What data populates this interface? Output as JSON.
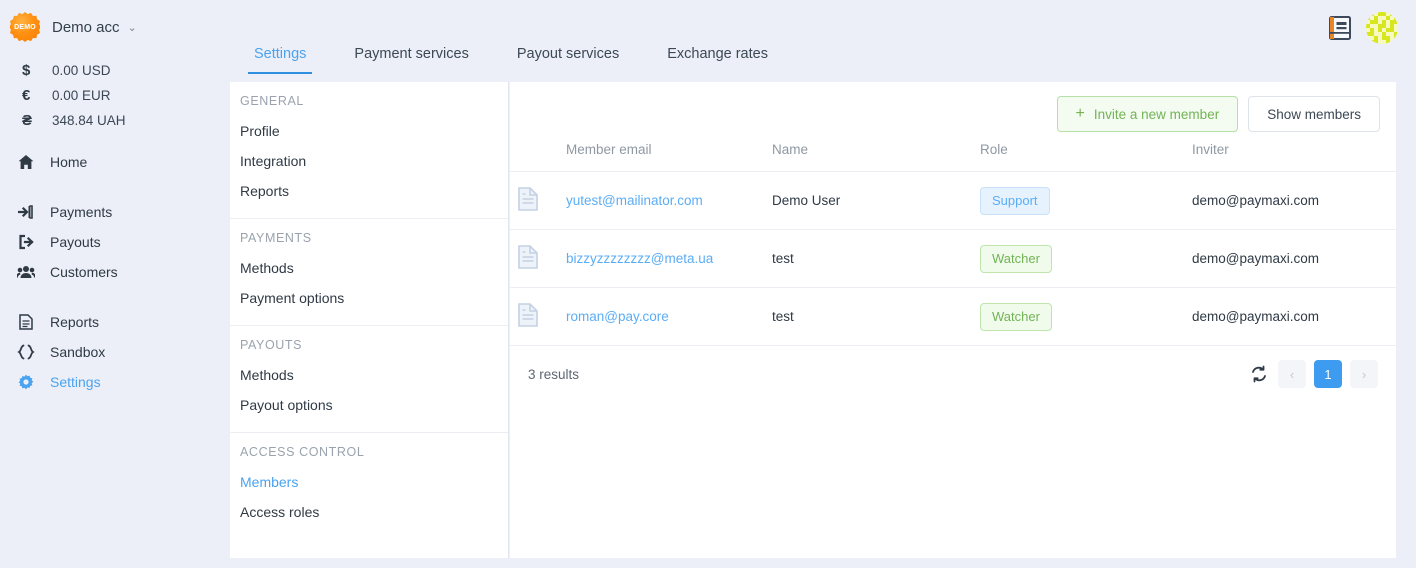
{
  "account": {
    "badge_text": "DEMO",
    "name": "Demo acc",
    "caret": "⌄"
  },
  "balances": [
    {
      "symbol": "$",
      "amount": "0.00 USD"
    },
    {
      "symbol": "€",
      "amount": "0.00 EUR"
    },
    {
      "symbol": "₴",
      "amount": "348.84 UAH"
    }
  ],
  "nav": [
    {
      "label": "Home",
      "icon": "home-icon",
      "active": false
    },
    {
      "label": "Payments",
      "icon": "payments-icon",
      "active": false
    },
    {
      "label": "Payouts",
      "icon": "payouts-icon",
      "active": false
    },
    {
      "label": "Customers",
      "icon": "customers-icon",
      "active": false
    },
    {
      "label": "Reports",
      "icon": "reports-icon",
      "active": false
    },
    {
      "label": "Sandbox",
      "icon": "sandbox-icon",
      "active": false
    },
    {
      "label": "Settings",
      "icon": "gear-icon",
      "active": true
    }
  ],
  "header_icons": {
    "docs": "book-icon",
    "avatar": "avatar-identicon"
  },
  "tabs": [
    {
      "label": "Settings",
      "active": true
    },
    {
      "label": "Payment services",
      "active": false
    },
    {
      "label": "Payout services",
      "active": false
    },
    {
      "label": "Exchange rates",
      "active": false
    }
  ],
  "submenu": [
    {
      "title": "GENERAL",
      "items": [
        {
          "label": "Profile",
          "active": false
        },
        {
          "label": "Integration",
          "active": false
        },
        {
          "label": "Reports",
          "active": false
        }
      ]
    },
    {
      "title": "PAYMENTS",
      "items": [
        {
          "label": "Methods",
          "active": false
        },
        {
          "label": "Payment options",
          "active": false
        }
      ]
    },
    {
      "title": "PAYOUTS",
      "items": [
        {
          "label": "Methods",
          "active": false
        },
        {
          "label": "Payout options",
          "active": false
        }
      ]
    },
    {
      "title": "ACCESS CONTROL",
      "items": [
        {
          "label": "Members",
          "active": true
        },
        {
          "label": "Access roles",
          "active": false
        }
      ]
    }
  ],
  "actions": {
    "invite_label": "Invite a new member",
    "invite_plus": "+",
    "show_members_label": "Show members"
  },
  "table": {
    "columns": [
      "Member email",
      "Name",
      "Role",
      "Inviter"
    ],
    "rows": [
      {
        "icon": "document-icon",
        "email": "yutest@mailinator.com",
        "name": "Demo User",
        "role": "Support",
        "role_type": "support",
        "inviter": "demo@paymaxi.com"
      },
      {
        "icon": "document-icon",
        "email": "bizzyzzzzzzzz@meta.ua",
        "name": "test",
        "role": "Watcher",
        "role_type": "watcher",
        "inviter": "demo@paymaxi.com"
      },
      {
        "icon": "document-icon",
        "email": "roman@pay.core",
        "name": "test",
        "role": "Watcher",
        "role_type": "watcher",
        "inviter": "demo@paymaxi.com"
      }
    ]
  },
  "footer": {
    "results": "3 results",
    "prev": "‹",
    "next": "›",
    "pages": [
      "1"
    ],
    "current_page": "1",
    "refresh": "refresh-icon"
  },
  "colors": {
    "accent_blue": "#4aa3f0",
    "page_bg": "#eceff7",
    "panel_bg": "#ffffff",
    "green": "#73b356",
    "orange": "#ff9012"
  }
}
